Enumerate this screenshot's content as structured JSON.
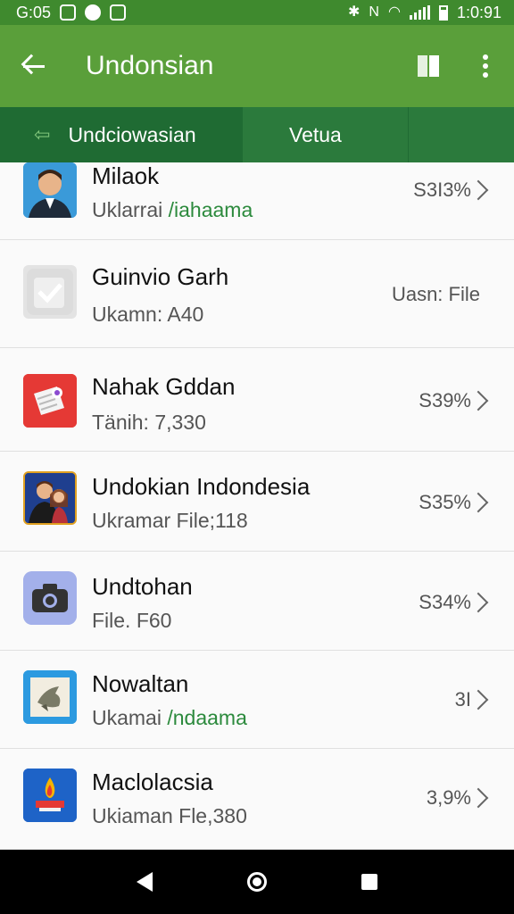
{
  "status_bar": {
    "time": "G:05",
    "clock_right": "1:0:91",
    "icons": [
      "notification-box-icon",
      "circle-icon",
      "app-icon",
      "bluetooth-icon",
      "nfc-icon",
      "wifi-icon",
      "signal-icon",
      "battery-icon"
    ]
  },
  "app_bar": {
    "title": "Undonsian",
    "icons": [
      "back-arrow-icon",
      "book-icon",
      "more-vert-icon"
    ]
  },
  "tabs": [
    {
      "label": "Undciowasian",
      "icon": "arrow-left-icon",
      "selected": true
    },
    {
      "label": "Vetua",
      "selected": false
    },
    {
      "label": "",
      "selected": false
    }
  ],
  "list": {
    "items": [
      {
        "title": "Milaok",
        "sub_prefix": "Uklarrai ",
        "sub_accent": "/iahaama",
        "right": "S3I3%",
        "icon": "person-avatar-icon",
        "icon_bg": "#2f8fcf"
      },
      {
        "title": "Guinvio Garh",
        "sub_prefix": "Ukamn: A40",
        "sub_accent": "",
        "right": "Uasn: File",
        "icon": "checkbox-icon",
        "icon_bg": "#e3e3e3"
      },
      {
        "title": "Nahak Gddan",
        "sub_prefix": "Tänih: 7,330",
        "sub_accent": "",
        "right": "S39%",
        "icon": "document-eye-icon",
        "icon_bg": "#e53935"
      },
      {
        "title": "Undokian Indondesia",
        "sub_prefix": "Ukramar File;118",
        "sub_accent": "",
        "right": "S35%",
        "icon": "couple-avatar-icon",
        "icon_bg": "#1e3a8a"
      },
      {
        "title": "Undtohan",
        "sub_prefix": "File. F60",
        "sub_accent": "",
        "right": "S34%",
        "icon": "camera-icon",
        "icon_bg": "#9aa8e6"
      },
      {
        "title": "Nowaltan",
        "sub_prefix": "Ukamai ",
        "sub_accent": "/ndaama",
        "right": "3I",
        "icon": "bird-icon",
        "icon_bg": "#2c9ae0"
      },
      {
        "title": "Maclolacsia",
        "sub_prefix": "Ukiaman Fle,380",
        "sub_accent": "",
        "right": "3,9%",
        "icon": "flame-icon",
        "icon_bg": "#1e63c7"
      }
    ]
  },
  "nav_bar": {
    "icons": [
      "nav-back-icon",
      "nav-home-icon",
      "nav-recent-icon"
    ]
  }
}
